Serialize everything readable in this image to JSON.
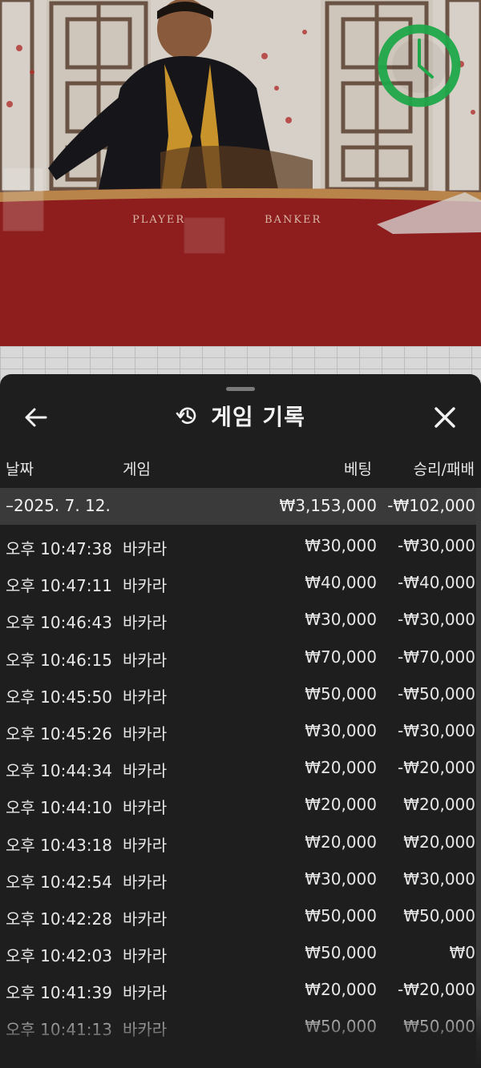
{
  "header": {
    "title": "게임 기록"
  },
  "columns": {
    "date": "날짜",
    "game": "게임",
    "bet": "베팅",
    "win_loss": "승리/패배"
  },
  "summary": {
    "date": "–2025. 7. 12.",
    "bet": "₩3,153,000",
    "win_loss": "-₩102,000"
  },
  "rows": [
    {
      "time": "오후 10:47:38",
      "game": "바카라",
      "bet": "₩30,000",
      "win_loss": "-₩30,000"
    },
    {
      "time": "오후 10:47:11",
      "game": "바카라",
      "bet": "₩40,000",
      "win_loss": "-₩40,000"
    },
    {
      "time": "오후 10:46:43",
      "game": "바카라",
      "bet": "₩30,000",
      "win_loss": "-₩30,000"
    },
    {
      "time": "오후 10:46:15",
      "game": "바카라",
      "bet": "₩70,000",
      "win_loss": "-₩70,000"
    },
    {
      "time": "오후 10:45:50",
      "game": "바카라",
      "bet": "₩50,000",
      "win_loss": "-₩50,000"
    },
    {
      "time": "오후 10:45:26",
      "game": "바카라",
      "bet": "₩30,000",
      "win_loss": "-₩30,000"
    },
    {
      "time": "오후 10:44:34",
      "game": "바카라",
      "bet": "₩20,000",
      "win_loss": "-₩20,000"
    },
    {
      "time": "오후 10:44:10",
      "game": "바카라",
      "bet": "₩20,000",
      "win_loss": "₩20,000"
    },
    {
      "time": "오후 10:43:18",
      "game": "바카라",
      "bet": "₩20,000",
      "win_loss": "₩20,000"
    },
    {
      "time": "오후 10:42:54",
      "game": "바카라",
      "bet": "₩30,000",
      "win_loss": "₩30,000"
    },
    {
      "time": "오후 10:42:28",
      "game": "바카라",
      "bet": "₩50,000",
      "win_loss": "₩50,000"
    },
    {
      "time": "오후 10:42:03",
      "game": "바카라",
      "bet": "₩50,000",
      "win_loss": "₩0"
    },
    {
      "time": "오후 10:41:39",
      "game": "바카라",
      "bet": "₩20,000",
      "win_loss": "-₩20,000"
    },
    {
      "time": "오후 10:41:13",
      "game": "바카라",
      "bet": "₩50,000",
      "win_loss": "₩50,000"
    }
  ],
  "table_felt": {
    "player_label": "PLAYER",
    "banker_label": "BANKER"
  },
  "colors": {
    "sheet_bg": "#1e1e1e",
    "summary_bg": "#3a3a3a",
    "timer_green": "#1fa84a",
    "felt_red": "#8e1d1d"
  },
  "icons": {
    "back": "arrow-left-icon",
    "history": "history-clock-icon",
    "close": "close-x-icon",
    "timer": "timer-clock-icon"
  }
}
